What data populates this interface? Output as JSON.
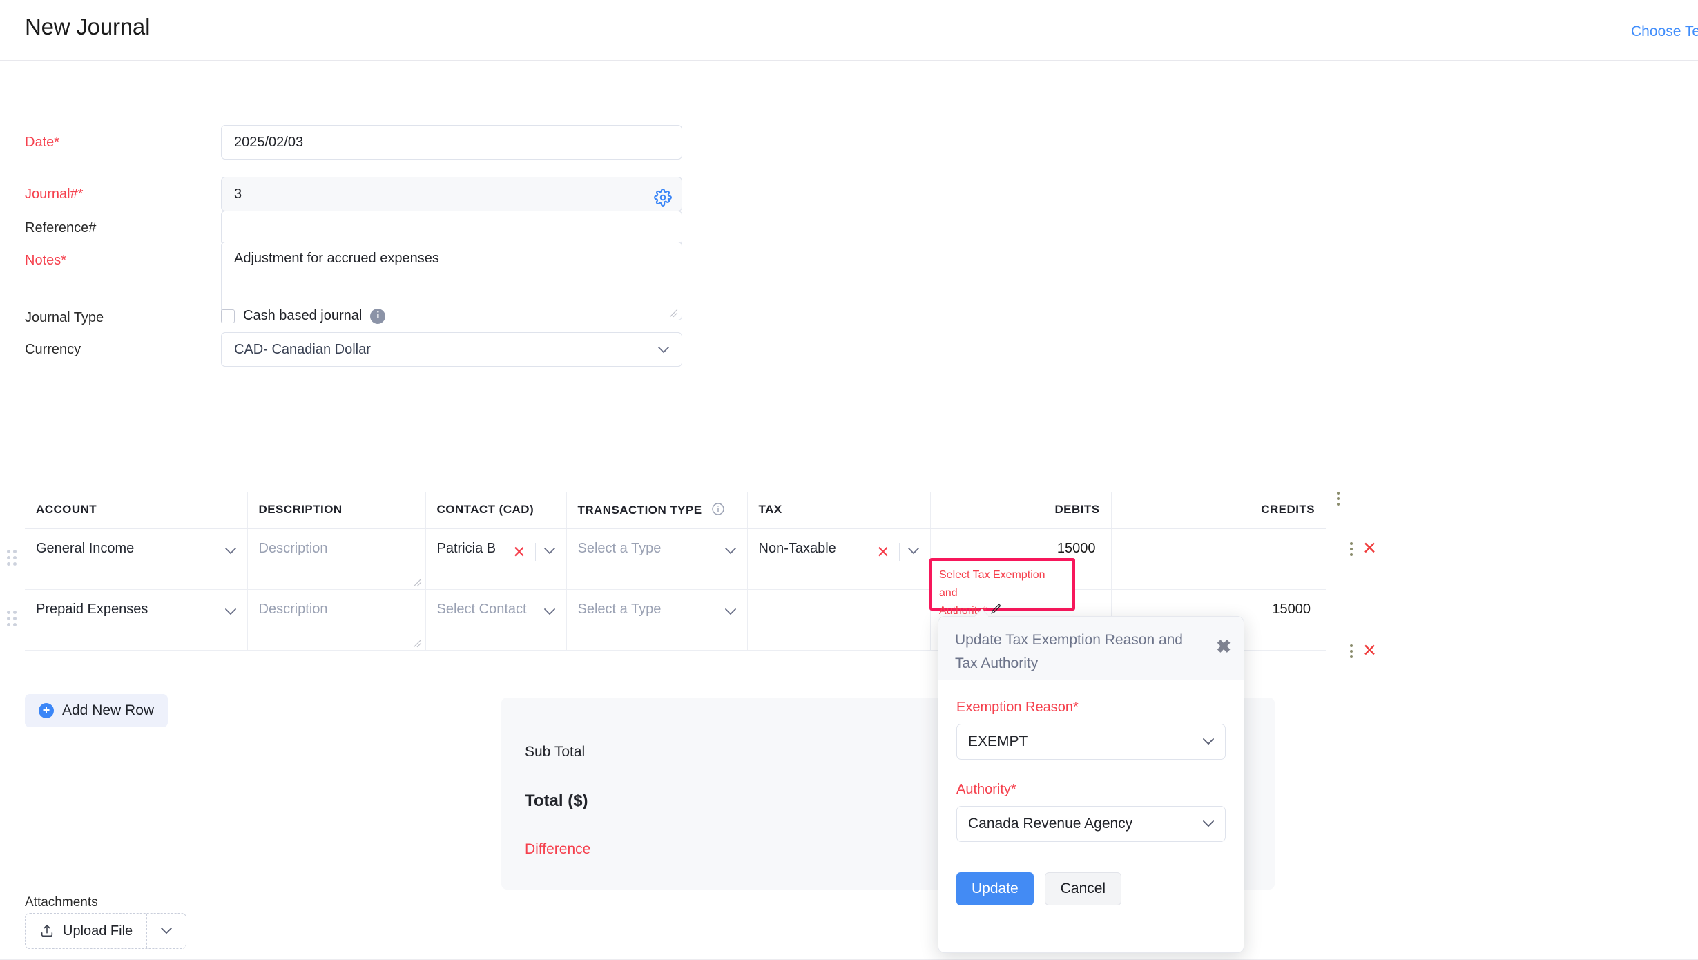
{
  "header": {
    "title": "New Journal",
    "choose_template_label": "Choose Te"
  },
  "form": {
    "date": {
      "label": "Date*",
      "value": "2025/02/03"
    },
    "journal_no": {
      "label": "Journal#*",
      "value": "3",
      "settings_icon": "gear-icon"
    },
    "reference_no": {
      "label": "Reference#",
      "value": ""
    },
    "notes": {
      "label": "Notes*",
      "value": "Adjustment for accrued expenses"
    },
    "journal_type": {
      "label": "Journal Type",
      "checkbox_label": "Cash based journal",
      "checked": false,
      "info_icon": "info-icon"
    },
    "currency": {
      "label": "Currency",
      "value": "CAD- Canadian Dollar"
    }
  },
  "line_items": {
    "columns": [
      "ACCOUNT",
      "DESCRIPTION",
      "CONTACT (CAD)",
      "TRANSACTION TYPE",
      "TAX",
      "DEBITS",
      "CREDITS"
    ],
    "transaction_type_info_icon": "info-icon",
    "rows": [
      {
        "account": "General Income",
        "description_placeholder": "Description",
        "description": "",
        "contact": "Patricia B",
        "contact_is_placeholder": false,
        "transaction_type": "Select a Type",
        "transaction_type_is_placeholder": true,
        "tax": "Non-Taxable",
        "tax_is_placeholder": false,
        "debits": "15000",
        "credits": ""
      },
      {
        "account": "Prepaid Expenses",
        "description_placeholder": "Description",
        "description": "",
        "contact": "Select Contact",
        "contact_is_placeholder": true,
        "transaction_type": "Select a Type",
        "transaction_type_is_placeholder": true,
        "tax": "",
        "tax_is_placeholder": true,
        "debits": "",
        "credits": "15000"
      }
    ],
    "tax_flag": {
      "line1": "Select Tax Exemption and",
      "line2": "Authority*",
      "edit_icon": "pencil-icon",
      "border_color": "#f7175b",
      "text_color": "#f5404d"
    }
  },
  "add_new_row_label": "Add New Row",
  "summary": {
    "sub_total_label": "Sub Total",
    "sub_total_value": "",
    "total_label": "Total ($)",
    "total_value": "",
    "difference_label": "Difference",
    "difference_value": ""
  },
  "attachments": {
    "label": "Attachments",
    "upload_label": "Upload File",
    "upload_icon": "upload-icon",
    "caret_icon": "chevron-down-icon"
  },
  "popover": {
    "title": "Update Tax Exemption Reason and Tax Authority",
    "close_icon": "close-icon",
    "exemption_reason": {
      "label": "Exemption Reason*",
      "value": "EXEMPT"
    },
    "authority": {
      "label": "Authority*",
      "value": "Canada Revenue Agency"
    },
    "update_label": "Update",
    "cancel_label": "Cancel",
    "primary_color": "#438bf4"
  }
}
